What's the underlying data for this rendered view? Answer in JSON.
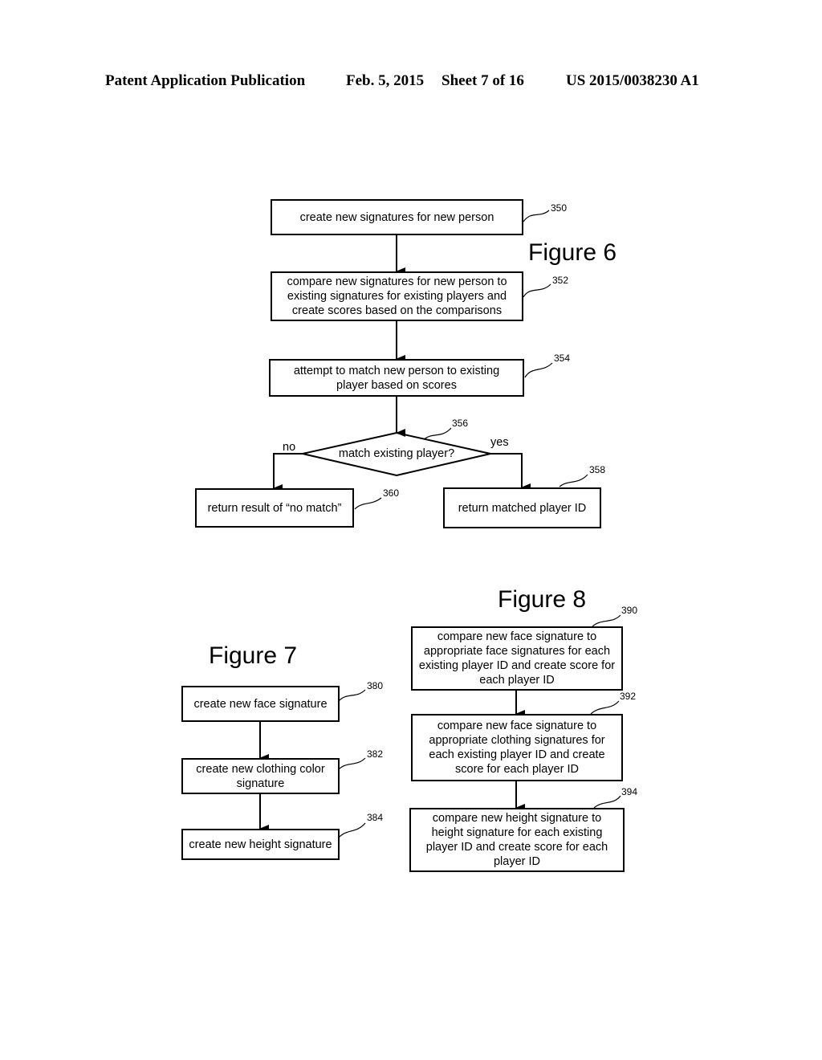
{
  "header": {
    "publication": "Patent Application Publication",
    "date": "Feb. 5, 2015",
    "sheet": "Sheet 7 of 16",
    "number": "US 2015/0038230 A1"
  },
  "figure6": {
    "title": "Figure 6",
    "steps": [
      {
        "ref": "350",
        "text": "create new signatures for new person"
      },
      {
        "ref": "352",
        "text": "compare new signatures for new person to existing signatures for existing players and create scores based on the comparisons"
      },
      {
        "ref": "354",
        "text": "attempt to match new person to existing player based on scores"
      }
    ],
    "decision": {
      "ref": "356",
      "text": "match existing player?",
      "no_label": "no",
      "yes_label": "yes"
    },
    "no_result": {
      "ref": "360",
      "text": "return result of “no match”"
    },
    "yes_result": {
      "ref": "358",
      "text": "return matched player ID"
    }
  },
  "figure7": {
    "title": "Figure 7",
    "steps": [
      {
        "ref": "380",
        "text": "create new face signature"
      },
      {
        "ref": "382",
        "text": "create new clothing color signature"
      },
      {
        "ref": "384",
        "text": "create new height signature"
      }
    ]
  },
  "figure8": {
    "title": "Figure 8",
    "steps": [
      {
        "ref": "390",
        "text": "compare new face signature to appropriate face signatures for each existing player ID and create score for each player ID"
      },
      {
        "ref": "392",
        "text": "compare new face signature to appropriate clothing signatures for each existing player ID and create score for each player ID"
      },
      {
        "ref": "394",
        "text": "compare new height signature to height signature for each existing player ID and create score for each player ID"
      }
    ]
  }
}
